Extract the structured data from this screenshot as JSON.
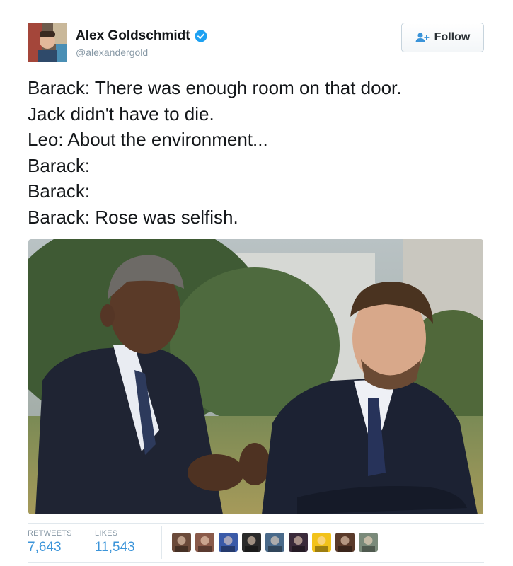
{
  "author": {
    "display_name": "Alex Goldschmidt",
    "handle": "@alexandergold",
    "verified": true,
    "avatar_icon": "user-avatar"
  },
  "follow_button": {
    "label": "Follow",
    "icon": "add-user-icon"
  },
  "tweet": {
    "lines": [
      "Barack: There was enough room on that door.",
      "Jack didn't have to die.",
      "Leo: About the environment...",
      "Barack:",
      "Barack:",
      "Barack: Rose was selfish."
    ]
  },
  "photo": {
    "icon": "tweet-photo"
  },
  "stats": {
    "retweets_label": "RETWEETS",
    "retweets_value": "7,643",
    "likes_label": "LIKES",
    "likes_value": "11,543"
  },
  "likers": [
    {
      "color": "#6b4a3a"
    },
    {
      "color": "#8a5a4a"
    },
    {
      "color": "#3a5aa8"
    },
    {
      "color": "#2a2a2a"
    },
    {
      "color": "#4a6a8a"
    },
    {
      "color": "#3a2a3a"
    },
    {
      "color": "#f2c21a"
    },
    {
      "color": "#5a3a2a"
    },
    {
      "color": "#7a8a7a"
    }
  ],
  "colors": {
    "accent": "#3b94d9",
    "verified": "#1da1f2",
    "muted": "#8899a6"
  }
}
